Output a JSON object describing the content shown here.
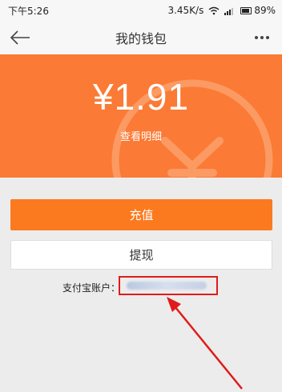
{
  "status_bar": {
    "time": "下午5:26",
    "network_speed": "3.45K/s",
    "battery": "89%"
  },
  "header": {
    "title": "我的钱包"
  },
  "wallet": {
    "balance": "¥1.91",
    "details_link": "查看明细"
  },
  "actions": {
    "recharge_label": "充值",
    "withdraw_label": "提现"
  },
  "alipay": {
    "label": "支付宝账户："
  },
  "colors": {
    "hero_bg": "#fb7a35",
    "recharge_bg": "#fb7a1f",
    "highlight": "#e01b1b"
  }
}
